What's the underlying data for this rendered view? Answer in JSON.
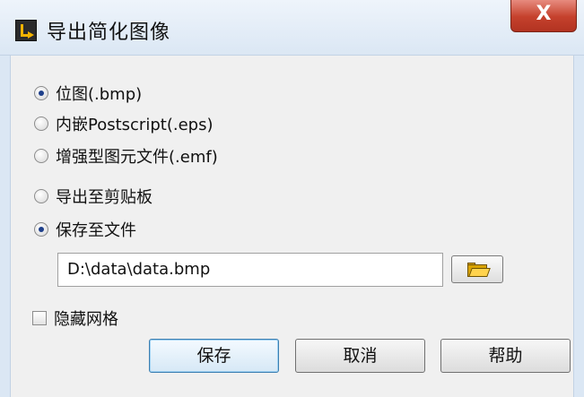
{
  "window": {
    "title": "导出简化图像",
    "close_label": "X"
  },
  "format_options": [
    {
      "label": "位图(.bmp)",
      "checked": true
    },
    {
      "label": "内嵌Postscript(.eps)",
      "checked": false
    },
    {
      "label": "增强型图元文件(.emf)",
      "checked": false
    }
  ],
  "destination_options": [
    {
      "label": "导出至剪贴板",
      "checked": false
    },
    {
      "label": "保存至文件",
      "checked": true
    }
  ],
  "path_field": {
    "value": "D:\\data\\data.bmp"
  },
  "hide_grid": {
    "label": "隐藏网格",
    "checked": false
  },
  "buttons": {
    "save": "保存",
    "cancel": "取消",
    "help": "帮助"
  },
  "icons": {
    "app": "labview-export-icon",
    "browse": "folder-icon"
  }
}
